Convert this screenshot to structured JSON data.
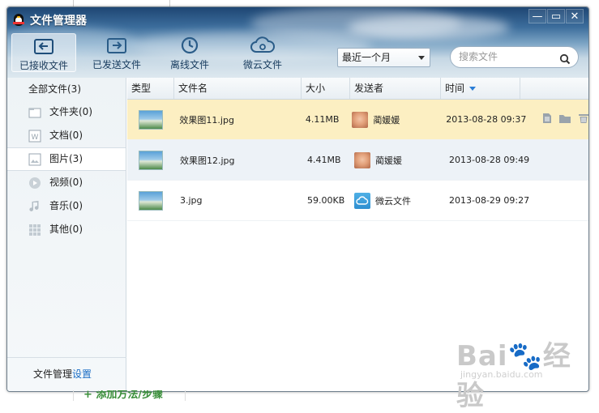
{
  "window": {
    "title": "文件管理器",
    "buttons": {
      "min": "—",
      "max": "▭",
      "close": "✕"
    }
  },
  "toolbar": {
    "items": [
      {
        "label": "已接收文件",
        "active": true
      },
      {
        "label": "已发送文件",
        "active": false
      },
      {
        "label": "离线文件",
        "active": false
      },
      {
        "label": "微云文件",
        "active": false
      }
    ]
  },
  "filter": {
    "selected": "最近一个月"
  },
  "search": {
    "placeholder": "搜索文件"
  },
  "sidebar": {
    "all_label": "全部文件(3)",
    "items": [
      {
        "label": "文件夹(0)",
        "icon": "folder-icon"
      },
      {
        "label": "文档(0)",
        "icon": "document-icon"
      },
      {
        "label": "图片(3)",
        "icon": "image-icon",
        "selected": true
      },
      {
        "label": "视频(0)",
        "icon": "video-icon"
      },
      {
        "label": "音乐(0)",
        "icon": "music-icon"
      },
      {
        "label": "其他(0)",
        "icon": "other-icon"
      }
    ],
    "footer_text": "文件管理",
    "footer_link": "设置"
  },
  "table": {
    "columns": [
      "类型",
      "文件名",
      "大小",
      "发送者",
      "时间"
    ],
    "rows": [
      {
        "name": "效果图11.jpg",
        "size": "4.11MB",
        "sender": "蔺媛媛",
        "time": "2013-08-28 09:37"
      },
      {
        "name": "效果图12.jpg",
        "size": "4.41MB",
        "sender": "蔺媛媛",
        "time": "2013-08-28 09:49"
      },
      {
        "name": "3.jpg",
        "size": "59.00KB",
        "sender": "微云文件",
        "time": "2013-08-29 09:27"
      }
    ]
  },
  "watermark": {
    "brand": "Bai du经验",
    "url": "jingyan.baidu.com"
  },
  "below_text": "+ 添加方法/步骤",
  "colors": {
    "selected_row": "#fcefc2",
    "hover_row": "#edf2f7",
    "link": "#1a6dc5",
    "accent_arrow": "#2a7dd6"
  }
}
